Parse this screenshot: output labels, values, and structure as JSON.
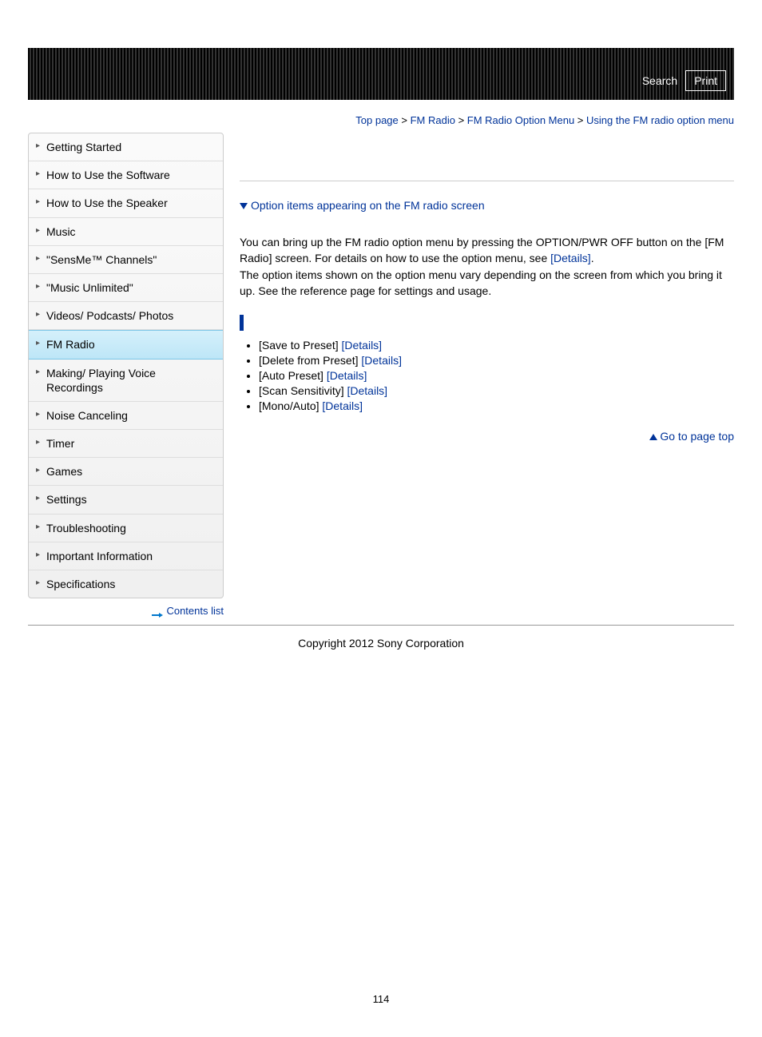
{
  "header": {
    "search": "Search",
    "print": "Print"
  },
  "breadcrumb": {
    "top": "Top page",
    "cat": "FM Radio",
    "subcat": "FM Radio Option Menu",
    "current": "Using the FM radio option menu",
    "sep": " > "
  },
  "sidebar": {
    "items": [
      "Getting Started",
      "How to Use the Software",
      "How to Use the Speaker",
      "Music",
      "\"SensMe™ Channels\"",
      "\"Music Unlimited\"",
      "Videos/ Podcasts/ Photos",
      "FM Radio",
      "Making/ Playing Voice Recordings",
      "Noise Canceling",
      "Timer",
      "Games",
      "Settings",
      "Troubleshooting",
      "Important Information",
      "Specifications"
    ],
    "activeIndex": 7,
    "contents_list": "Contents list"
  },
  "main": {
    "anchor": "Option items appearing on the FM radio screen",
    "para1a": "You can bring up the FM radio option menu by pressing the OPTION/PWR OFF button on the [FM Radio] screen. For details on how to use the option menu, see ",
    "para1_link": "[Details]",
    "para1b": ".",
    "para2": "The option items shown on the option menu vary depending on the screen from which you bring it up. See the reference page for settings and usage.",
    "options": [
      {
        "label": "[Save to Preset] ",
        "link": "[Details]"
      },
      {
        "label": "[Delete from Preset] ",
        "link": "[Details]"
      },
      {
        "label": "[Auto Preset] ",
        "link": "[Details]"
      },
      {
        "label": "[Scan Sensitivity] ",
        "link": "[Details]"
      },
      {
        "label": "[Mono/Auto] ",
        "link": "[Details]"
      }
    ],
    "pagetop": "Go to page top"
  },
  "footer": {
    "copyright": "Copyright 2012 Sony Corporation",
    "page_number": "114"
  }
}
